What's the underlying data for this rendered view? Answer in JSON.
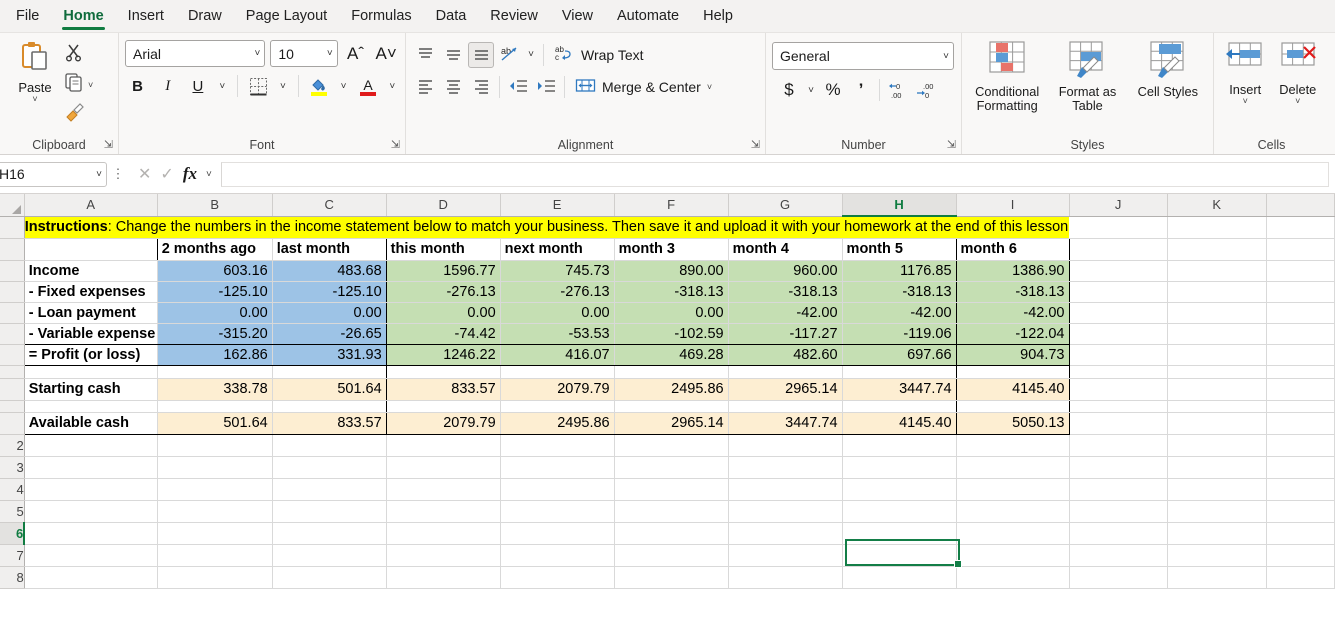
{
  "ribbon_tabs": [
    {
      "label": "File",
      "active": false
    },
    {
      "label": "Home",
      "active": true
    },
    {
      "label": "Insert",
      "active": false
    },
    {
      "label": "Draw",
      "active": false
    },
    {
      "label": "Page Layout",
      "active": false
    },
    {
      "label": "Formulas",
      "active": false
    },
    {
      "label": "Data",
      "active": false
    },
    {
      "label": "Review",
      "active": false
    },
    {
      "label": "View",
      "active": false
    },
    {
      "label": "Automate",
      "active": false
    },
    {
      "label": "Help",
      "active": false
    }
  ],
  "ribbon": {
    "clipboard": {
      "group_label": "Clipboard",
      "paste_label": "Paste",
      "cut_icon": "scissors-icon",
      "copy_icon": "copy-icon",
      "format_painter_icon": "format-painter-icon"
    },
    "font": {
      "group_label": "Font",
      "font_name": "Arial",
      "font_size": "10",
      "grow_font_icon": "grow-font-icon",
      "shrink_font_icon": "shrink-font-icon",
      "bold_label": "B",
      "italic_label": "I",
      "underline_label": "U",
      "borders_icon": "borders-icon",
      "fill_color_icon": "fill-color-icon",
      "font_color_icon": "font-color-icon"
    },
    "alignment": {
      "group_label": "Alignment",
      "wrap_text_label": "Wrap Text",
      "merge_center_label": "Merge & Center",
      "orientation_icon": "text-orientation-icon",
      "decrease_indent_icon": "decrease-indent-icon",
      "increase_indent_icon": "increase-indent-icon"
    },
    "number": {
      "group_label": "Number",
      "format": "General",
      "currency_icon": "currency-icon",
      "percent_label": "%",
      "comma_label": "‰",
      "increase_decimal_label": ".00",
      "decrease_decimal_label": ".00"
    },
    "styles": {
      "group_label": "Styles",
      "conditional_formatting_label": "Conditional Formatting",
      "format_as_table_label": "Format as Table",
      "cell_styles_label": "Cell Styles"
    },
    "cells": {
      "group_label": "Cells",
      "insert_label": "Insert",
      "delete_label": "Delete"
    }
  },
  "formula_bar": {
    "name_box": "H16",
    "cancel_icon": "cancel-icon",
    "enter_icon": "confirm-icon",
    "function_icon": "fx-icon",
    "formula_value": ""
  },
  "grid": {
    "column_headers": [
      "A",
      "B",
      "C",
      "D",
      "E",
      "F",
      "G",
      "H",
      "I",
      "J",
      "K"
    ],
    "selected_column": "H",
    "selected_cell": "H16",
    "row_headers": [
      "",
      "",
      "",
      "",
      "",
      "",
      "",
      "",
      "",
      "",
      "",
      "2",
      "3",
      "4",
      "5",
      "6",
      "7",
      "8"
    ],
    "instructions_bold": "Instructions",
    "instructions_rest": ": Change the numbers in the income statement below to match your business. Then save it and upload it with your homework at the end of this lesson",
    "period_headers": [
      "",
      "2 months ago",
      "last month",
      "this month",
      "next month",
      "month 3",
      "month 4",
      "month 5",
      "month 6"
    ],
    "rows": [
      {
        "label": "Income",
        "values": [
          "603.16",
          "483.68",
          "1596.77",
          "745.73",
          "890.00",
          "960.00",
          "1176.85",
          "1386.90"
        ]
      },
      {
        "label": "- Fixed expenses",
        "values": [
          "-125.10",
          "-125.10",
          "-276.13",
          "-276.13",
          "-318.13",
          "-318.13",
          "-318.13",
          "-318.13"
        ]
      },
      {
        "label": "- Loan payment",
        "values": [
          "0.00",
          "0.00",
          "0.00",
          "0.00",
          "0.00",
          "-42.00",
          "-42.00",
          "-42.00"
        ]
      },
      {
        "label": "- Variable expense",
        "values": [
          "-315.20",
          "-26.65",
          "-74.42",
          "-53.53",
          "-102.59",
          "-117.27",
          "-119.06",
          "-122.04"
        ]
      },
      {
        "label": "= Profit (or loss)",
        "values": [
          "162.86",
          "331.93",
          "1246.22",
          "416.07",
          "469.28",
          "482.60",
          "697.66",
          "904.73"
        ]
      }
    ],
    "cash_rows": [
      {
        "label": "Starting cash",
        "values": [
          "338.78",
          "501.64",
          "833.57",
          "2079.79",
          "2495.86",
          "2965.14",
          "3447.74",
          "4145.40"
        ]
      },
      {
        "label": "Available cash",
        "values": [
          "501.64",
          "833.57",
          "2079.79",
          "2495.86",
          "2965.14",
          "3447.74",
          "4145.40",
          "5050.13"
        ]
      }
    ],
    "colors": {
      "past_fill": "#9dc3e6",
      "forecast_fill": "#c5dfb3",
      "cash_fill": "#fdeed2",
      "instructions_fill": "#ffff00",
      "selection": "#137e47"
    }
  }
}
